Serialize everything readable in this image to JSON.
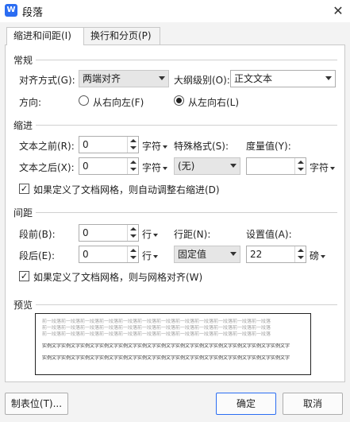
{
  "window": {
    "title": "段落",
    "app_icon_letter": "W",
    "close_glyph": "✕"
  },
  "tabs": [
    {
      "label": "缩进和间距(I)",
      "active": true
    },
    {
      "label": "换行和分页(P)",
      "active": false
    }
  ],
  "general": {
    "title": "常规",
    "alignment_label": "对齐方式(G):",
    "alignment_value": "两端对齐",
    "outline_label": "大纲级别(O):",
    "outline_value": "正文文本",
    "direction_label": "方向:",
    "direction_rtl_label": "从右向左(F)",
    "direction_ltr_label": "从左向右(L)",
    "direction_selected": "ltr"
  },
  "indent": {
    "title": "缩进",
    "before_label": "文本之前(R):",
    "before_value": "0",
    "before_unit": "字符",
    "after_label": "文本之后(X):",
    "after_value": "0",
    "after_unit": "字符",
    "special_label": "特殊格式(S):",
    "special_value": "(无)",
    "measure_label": "度量值(Y):",
    "measure_value": "",
    "measure_unit": "字符",
    "auto_adjust_label": "如果定义了文档网格，则自动调整右缩进(D)",
    "auto_adjust_checked": true
  },
  "spacing": {
    "title": "间距",
    "before_label": "段前(B):",
    "before_value": "0",
    "before_unit": "行",
    "after_label": "段后(E):",
    "after_value": "0",
    "after_unit": "行",
    "line_label": "行距(N):",
    "line_value": "固定值",
    "setting_label": "设置值(A):",
    "setting_value": "22",
    "setting_unit": "磅",
    "snap_grid_label": "如果定义了文档网格，则与网格对齐(W)",
    "snap_grid_checked": true
  },
  "preview": {
    "title": "预览",
    "prev_line": "前一段落前一段落前一段落前一段落前一段落前一段落前一段落前一段落前一段落前一段落前一段落前一段落",
    "sample_line": "实例文字实例文字实例文字实例文字实例文字实例文字实例文字实例文字实例文字实例文字实例文字实例文字实例文字"
  },
  "buttons": {
    "tabs": "制表位(T)...",
    "ok": "确定",
    "cancel": "取消"
  },
  "colors": {
    "accent": "#2b6df2",
    "panel_bg": "#f3f3f3",
    "combo_bg": "#e6e6e6"
  }
}
